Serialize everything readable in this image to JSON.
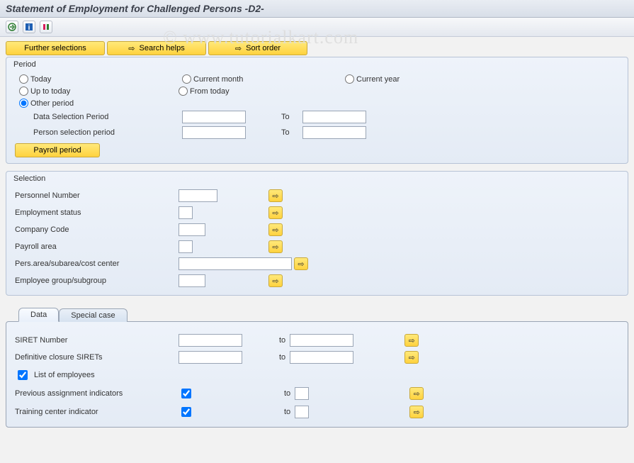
{
  "title": "Statement of Employment for Challenged Persons -D2-",
  "watermark": "© www.tutorialkart.com",
  "buttons": {
    "further_selections": "Further selections",
    "search_helps": "Search helps",
    "sort_order": "Sort order",
    "payroll_period": "Payroll period"
  },
  "period": {
    "legend": "Period",
    "today": "Today",
    "current_month": "Current month",
    "current_year": "Current year",
    "up_to_today": "Up to today",
    "from_today": "From today",
    "other_period": "Other period",
    "data_selection_period": "Data Selection Period",
    "person_selection_period": "Person selection period",
    "to": "To",
    "selected": "other_period",
    "data_from": "",
    "data_to": "",
    "person_from": "",
    "person_to": ""
  },
  "selection": {
    "legend": "Selection",
    "personnel_number": {
      "label": "Personnel Number",
      "value": ""
    },
    "employment_status": {
      "label": "Employment status",
      "value": ""
    },
    "company_code": {
      "label": "Company Code",
      "value": ""
    },
    "payroll_area": {
      "label": "Payroll area",
      "value": ""
    },
    "pers_area": {
      "label": "Pers.area/subarea/cost center",
      "value": ""
    },
    "employee_group": {
      "label": "Employee group/subgroup",
      "value": ""
    }
  },
  "tabs": {
    "data": "Data",
    "special_case": "Special case",
    "active": "data"
  },
  "data_tab": {
    "siret": {
      "label": "SIRET Number",
      "from": "",
      "to": ""
    },
    "def_closure": {
      "label": "Definitive closure SIRETs",
      "from": "",
      "to": ""
    },
    "list_employees": {
      "label": "List of employees",
      "checked": true
    },
    "prev_assign": {
      "label": "Previous assignment indicators",
      "from_checked": true,
      "to": ""
    },
    "training": {
      "label": "Training center indicator",
      "from_checked": true,
      "to": ""
    },
    "to": "to"
  }
}
